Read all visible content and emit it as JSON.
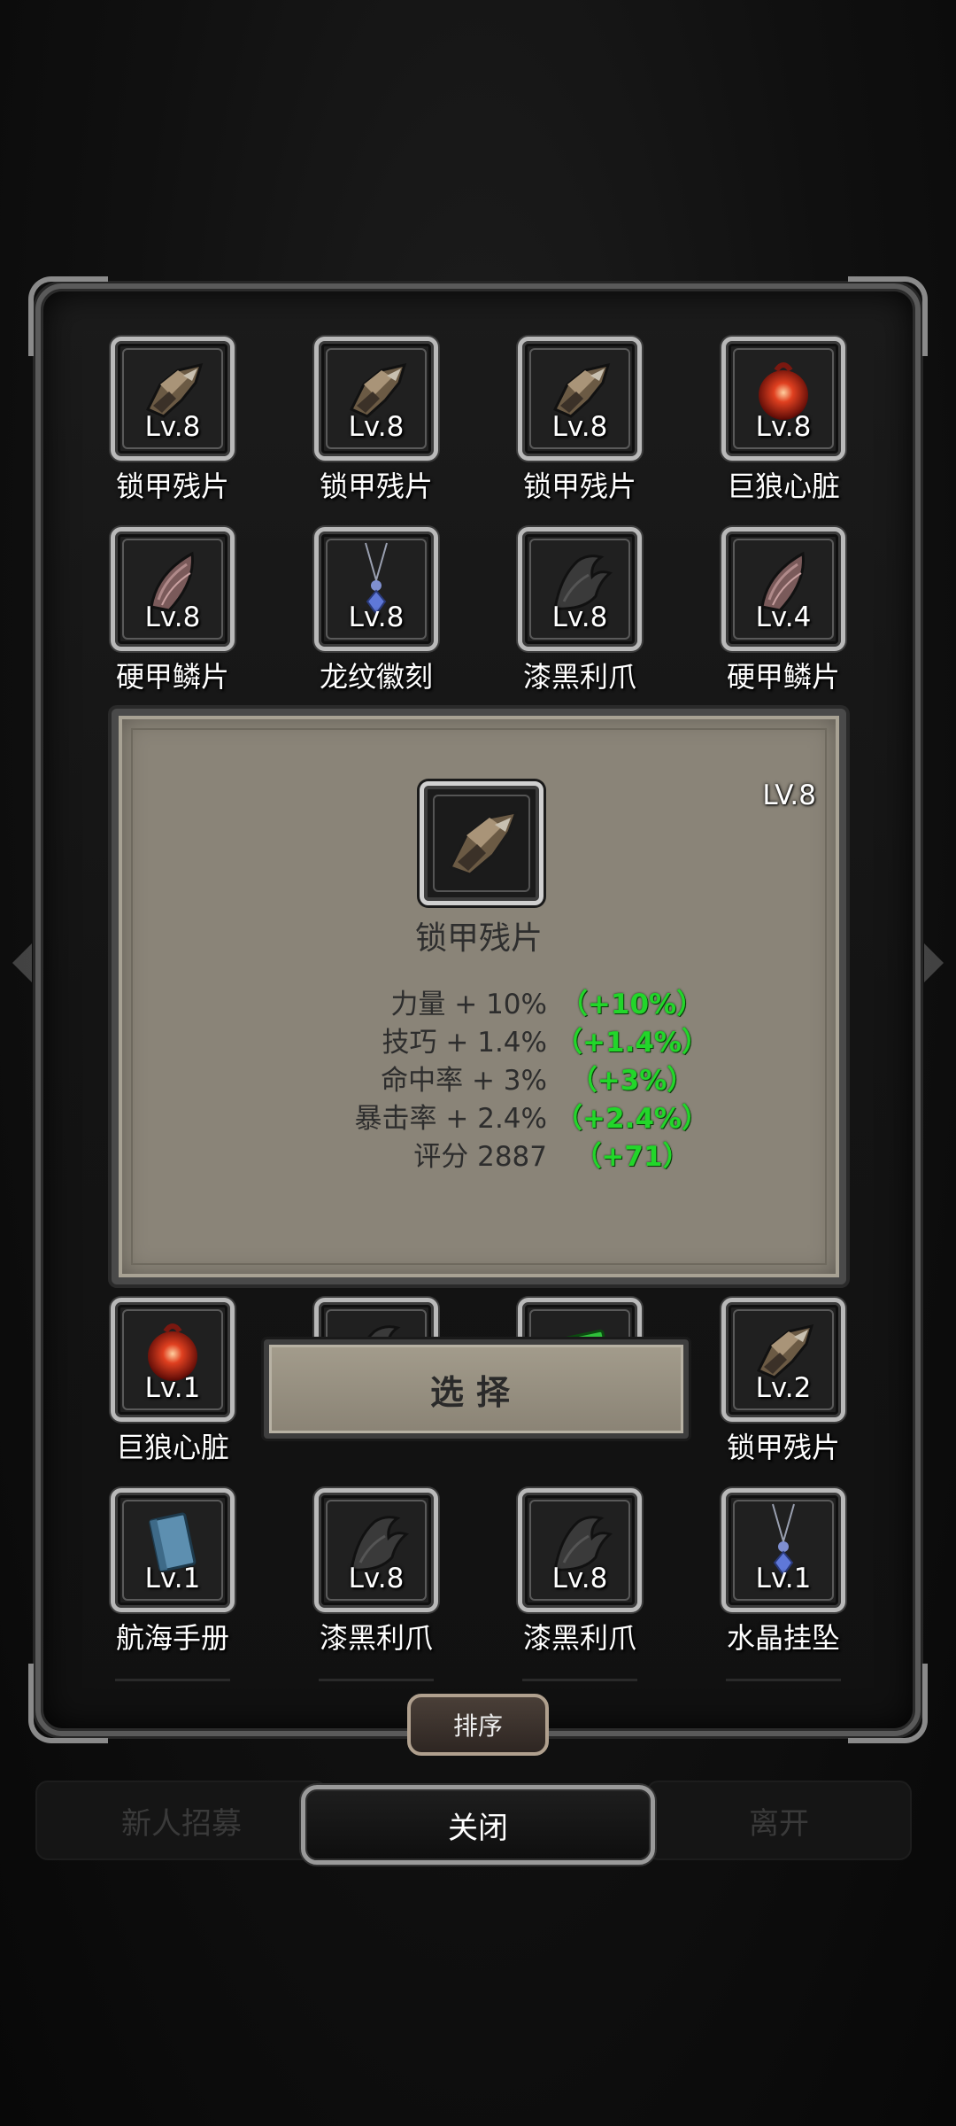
{
  "inventory": {
    "items": [
      {
        "name": "锁甲残片",
        "level": "Lv.8",
        "icon": "armor-fragment-icon"
      },
      {
        "name": "锁甲残片",
        "level": "Lv.8",
        "icon": "armor-fragment-icon"
      },
      {
        "name": "锁甲残片",
        "level": "Lv.8",
        "icon": "armor-fragment-icon"
      },
      {
        "name": "巨狼心脏",
        "level": "Lv.8",
        "icon": "wolf-heart-icon"
      },
      {
        "name": "硬甲鳞片",
        "level": "Lv.8",
        "icon": "scale-icon"
      },
      {
        "name": "龙纹徽刻",
        "level": "Lv.8",
        "icon": "pendant-icon"
      },
      {
        "name": "漆黑利爪",
        "level": "Lv.8",
        "icon": "claw-icon"
      },
      {
        "name": "硬甲鳞片",
        "level": "Lv.4",
        "icon": "scale-icon"
      },
      {
        "name": "巨狼心脏",
        "level": "Lv.1",
        "icon": "wolf-heart-icon"
      },
      {
        "name": "",
        "level": "",
        "icon": "claw-icon"
      },
      {
        "name": "",
        "level": "",
        "icon": "green-gem-icon"
      },
      {
        "name": "锁甲残片",
        "level": "Lv.2",
        "icon": "armor-fragment-icon"
      },
      {
        "name": "航海手册",
        "level": "Lv.1",
        "icon": "book-icon"
      },
      {
        "name": "漆黑利爪",
        "level": "Lv.8",
        "icon": "claw-icon"
      },
      {
        "name": "漆黑利爪",
        "level": "Lv.8",
        "icon": "claw-icon"
      },
      {
        "name": "水晶挂坠",
        "level": "Lv.1",
        "icon": "pendant-icon"
      }
    ]
  },
  "detail": {
    "name": "锁甲残片",
    "level": "LV.8",
    "icon": "armor-fragment-icon",
    "stats": [
      {
        "label": "力量 + 10%",
        "bonus": "（+10%）"
      },
      {
        "label": "技巧 + 1.4%",
        "bonus": "（+1.4%）"
      },
      {
        "label": "命中率 + 3%",
        "bonus": "（+3%）"
      },
      {
        "label": "暴击率 + 2.4%",
        "bonus": "（+2.4%）"
      },
      {
        "label": "评分 2887",
        "bonus": "（+71）"
      }
    ],
    "select_label": "选择"
  },
  "controls": {
    "sort_label": "排序",
    "close_label": "关闭"
  },
  "background": {
    "left_button": "新人招募",
    "right_button": "离开"
  },
  "colors": {
    "bonus_green": "#22d62a",
    "panel_parchment": "#8a8478",
    "window_bg": "#161616"
  }
}
